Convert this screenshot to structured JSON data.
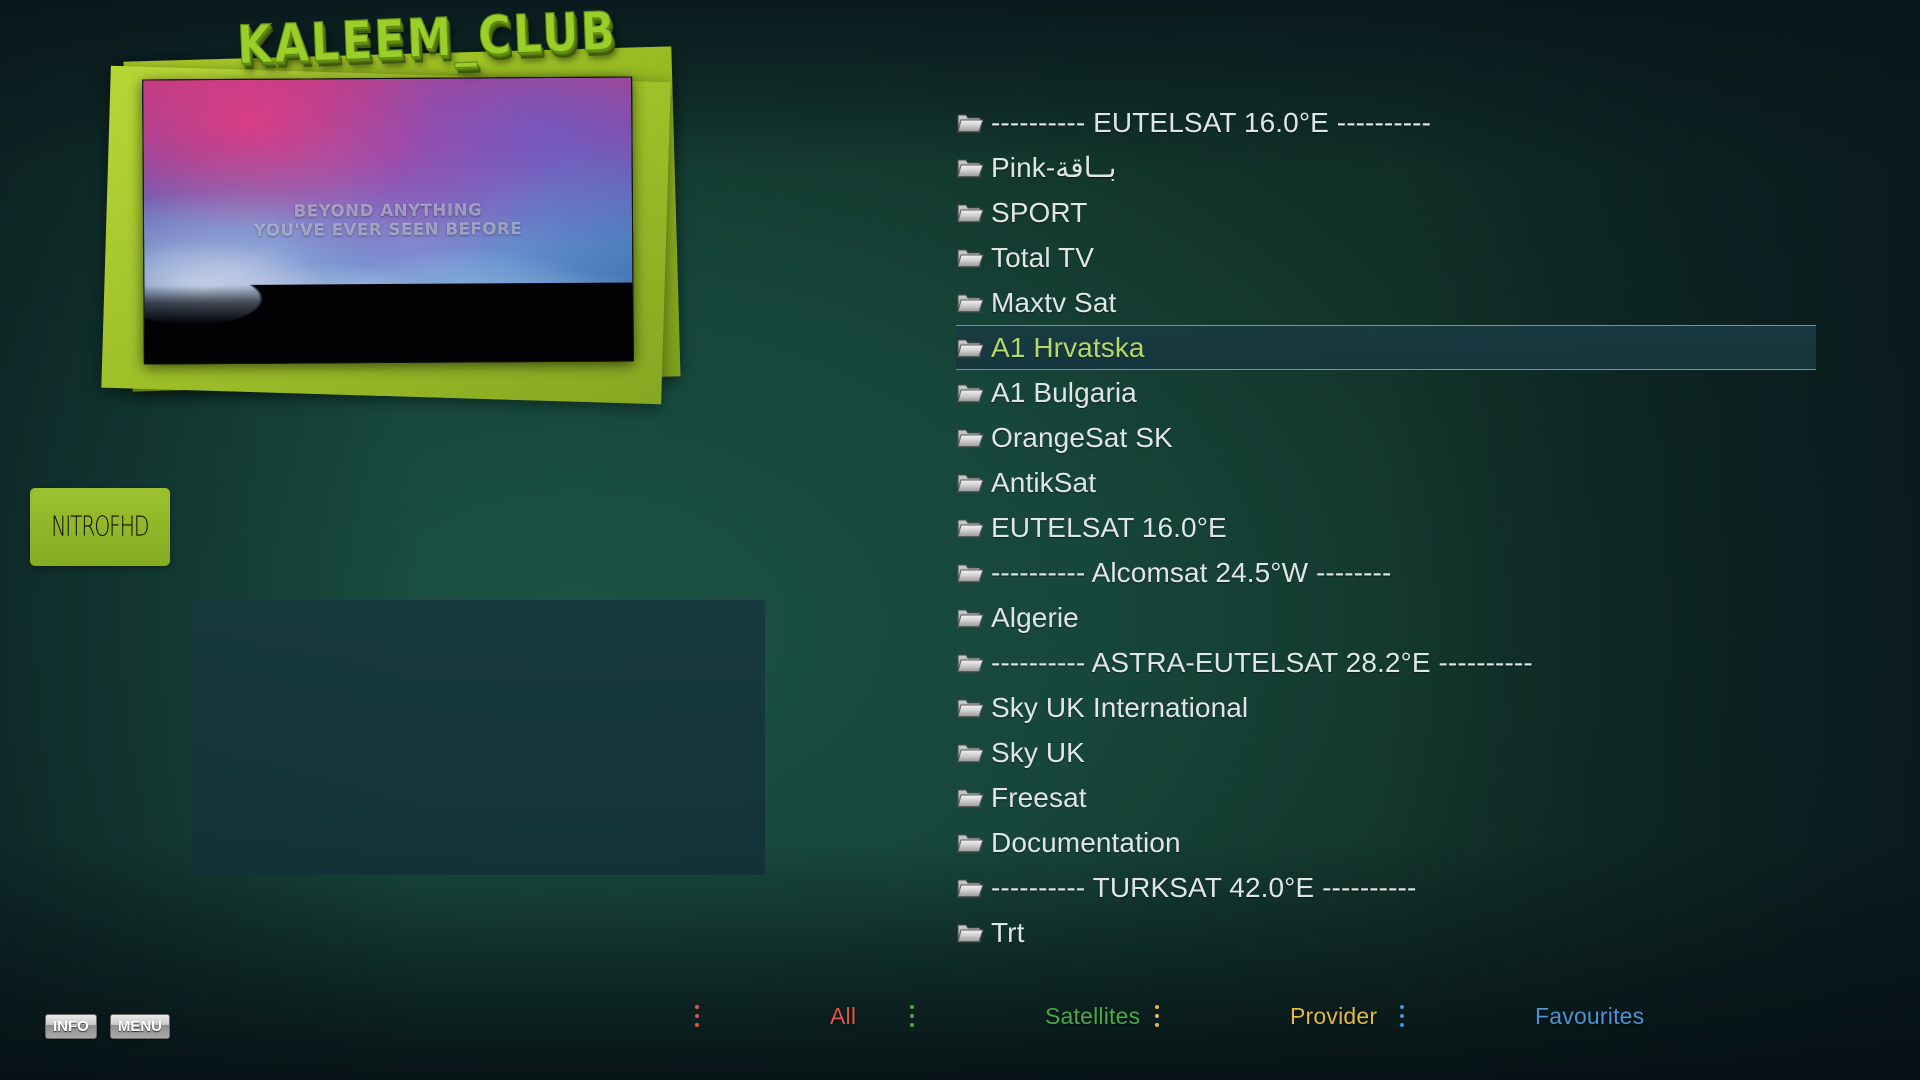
{
  "brand": {
    "logo_text": "KALEEM_CLUB",
    "badge_text": "NITROFHD"
  },
  "preview": {
    "caption": "BEYOND ANYTHING\nYOU'VE EVER SEEN BEFORE"
  },
  "channel_list": {
    "selected_index": 5,
    "rows": [
      {
        "label": "---------- EUTELSAT 16.0°E ----------",
        "type": "separator"
      },
      {
        "label": "Pink-بــاقة",
        "type": "bouquet"
      },
      {
        "label": "SPORT",
        "type": "bouquet"
      },
      {
        "label": "Total TV",
        "type": "bouquet"
      },
      {
        "label": "Maxtv Sat",
        "type": "bouquet"
      },
      {
        "label": "A1 Hrvatska",
        "type": "bouquet"
      },
      {
        "label": "A1 Bulgaria",
        "type": "bouquet"
      },
      {
        "label": "OrangeSat SK",
        "type": "bouquet"
      },
      {
        "label": "AntikSat",
        "type": "bouquet"
      },
      {
        "label": "EUTELSAT 16.0°E",
        "type": "bouquet"
      },
      {
        "label": "---------- Alcomsat 24.5°W --------",
        "type": "separator"
      },
      {
        "label": "Algerie",
        "type": "bouquet"
      },
      {
        "label": "---------- ASTRA-EUTELSAT 28.2°E ----------",
        "type": "separator"
      },
      {
        "label": "Sky UK International",
        "type": "bouquet"
      },
      {
        "label": "Sky UK",
        "type": "bouquet"
      },
      {
        "label": "Freesat",
        "type": "bouquet"
      },
      {
        "label": "Documentation",
        "type": "bouquet"
      },
      {
        "label": "---------- TURKSAT 42.0°E ----------",
        "type": "separator"
      },
      {
        "label": "Trt",
        "type": "bouquet"
      }
    ]
  },
  "bottom_bar": {
    "hardware_buttons": [
      {
        "label": "INFO"
      },
      {
        "label": "MENU"
      }
    ],
    "color_keys": [
      {
        "label": "All",
        "color": "#e0564c"
      },
      {
        "label": "Satellites",
        "color": "#4aa94a"
      },
      {
        "label": "Provider",
        "color": "#e0b84b"
      },
      {
        "label": "Favourites",
        "color": "#4a93d6"
      }
    ]
  },
  "colors": {
    "accent_green": "#9ace29",
    "highlight_text": "#b3d96a",
    "highlight_border": "#8d9a3e",
    "list_text": "#dfe6e6",
    "panel_bg": "#163840"
  }
}
